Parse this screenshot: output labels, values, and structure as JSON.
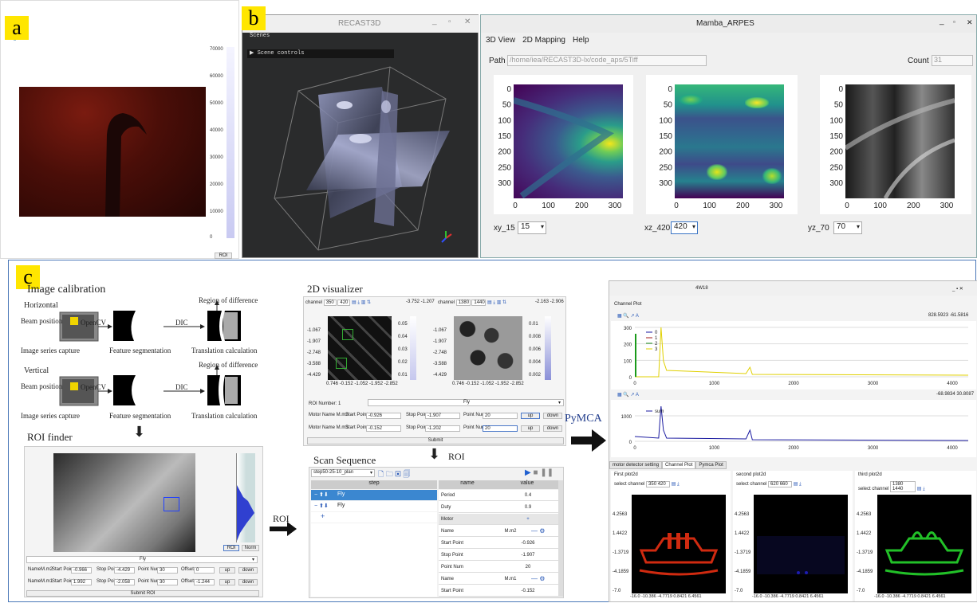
{
  "labels": {
    "a": "a",
    "b": "b",
    "c": "c"
  },
  "panel_a": {
    "roi_button": "ROI",
    "colorbar_ticks": [
      "70000",
      "60000",
      "50000",
      "40000",
      "30000",
      "20000",
      "10000",
      "0"
    ]
  },
  "panel_b": {
    "title": "RECAST3D",
    "menu": "Scenes",
    "scene_controls": "▶ Scene controls",
    "win_min": "_",
    "win_max": "▫",
    "win_close": "✕"
  },
  "panel_arpes": {
    "title": "Mamba_ARPES",
    "menu": [
      "3D View",
      "2D Mapping",
      "Help"
    ],
    "path_label": "Path",
    "path_value": "/home/iea/RECAST3D-lx/code_aps/5Tiff",
    "count_label": "Count",
    "count_value": "31",
    "y_ticks": [
      "0",
      "50",
      "100",
      "150",
      "200",
      "250",
      "300"
    ],
    "x_ticks": [
      "0",
      "100",
      "200",
      "300"
    ],
    "plots": [
      {
        "label": "xy_15",
        "value": "15"
      },
      {
        "label": "xz_420",
        "value": "420"
      },
      {
        "label": "yz_70",
        "value": "70"
      }
    ],
    "win_min": "_",
    "win_max": "▫",
    "win_close": "✕"
  },
  "panel_c": {
    "image_calibration": "Image calibration",
    "horizontal": "Horizontal",
    "vertical": "Vertical",
    "beam_position": "Beam position",
    "opencv": "OpenCV",
    "dic": "DIC",
    "region_of_difference": "Region of difference",
    "image_series_capture": "Image series capture",
    "feature_segmentation": "Feature segmentation",
    "translation_calculation": "Translation calculation",
    "roi_finder": "ROI finder",
    "roi_arrow": "ROI",
    "roi_panel": {
      "mode": "Fly",
      "row1": {
        "name": "Name",
        "motor": "M.m2",
        "start": "Start Point",
        "start_val": "-0.966",
        "stop": "Stop Point",
        "stop_val": "-4.429",
        "num": "Point Num",
        "num_val": "30",
        "offset": "Offset",
        "offset_val": "0",
        "up": "up",
        "down": "down"
      },
      "row2": {
        "name": "Name",
        "motor": "M.m1",
        "start": "Start Point",
        "start_val": "1.992",
        "stop": "Stop Point",
        "stop_val": "-2.058",
        "num": "Point Num",
        "num_val": "30",
        "offset": "Offset",
        "offset_val": "-1.244",
        "up": "up",
        "down": "down"
      },
      "submit": "Submit ROI",
      "roi_btn": "ROI",
      "norm_btn": "Norm"
    },
    "viz_title": "2D visualizer",
    "viz": {
      "channel1": "channel",
      "ch1_a": "350",
      "ch1_b": "420",
      "coord1": "-3.752 -1.207",
      "channel2": "channel",
      "ch2_a": "1380",
      "ch2_b": "1440",
      "coord2": "-2.163 -2.906",
      "y_ticks": [
        "-1.067",
        "-1.907",
        "-2.748",
        "-3.588",
        "-4.429"
      ],
      "x_ticks1": "0.746 -0.152 -1.052 -1.952 -2.852",
      "x_ticks2": "0.746 -0.152 -1.052 -1.952 -2.852",
      "cb1": [
        "0.05",
        "0.04",
        "0.03",
        "0.02",
        "0.01"
      ],
      "cb2": [
        "0.01",
        "0.008",
        "0.006",
        "0.004",
        "0.002"
      ],
      "roi_number": "ROI Number: 1",
      "fly": "Fly",
      "r1": {
        "motor": "Motor Name M.m2",
        "start": "Start Point",
        "start_val": "-0.926",
        "stop": "Stop Point",
        "stop_val": "-1.907",
        "num": "Point Num",
        "num_val": "20",
        "up": "up",
        "down": "down"
      },
      "r2": {
        "motor": "Motor Name M.m1",
        "start": "Start Point",
        "start_val": "-0.152",
        "stop": "Stop Point",
        "stop_val": "-1.202",
        "num": "Point Num",
        "num_val": "20",
        "up": "up",
        "down": "down"
      },
      "submit": "Submit"
    },
    "roi_label2": "ROI",
    "scan_title": "Scan Sequence",
    "scan": {
      "plan": "step50-25-10_plan",
      "step_header": "step",
      "name_header": "name",
      "value_header": "value",
      "steps": [
        "Fly",
        "Fly"
      ],
      "rows": [
        {
          "n": "Period",
          "v": "0.4"
        },
        {
          "n": "Duty",
          "v": "0.9"
        },
        {
          "n": "Motor",
          "v": "+"
        },
        {
          "n": "Name",
          "v": "M.m2"
        },
        {
          "n": "Start Point",
          "v": "-0.926"
        },
        {
          "n": "Stop Point",
          "v": "-1.907"
        },
        {
          "n": "Point Num",
          "v": "20"
        },
        {
          "n": "Name",
          "v": "M.m1"
        },
        {
          "n": "Start Point",
          "v": "-0.152"
        }
      ]
    },
    "pymca": "PyMCA",
    "pymca_win": {
      "title": "4W18",
      "channel_plot": "Channel Plot",
      "coord1": "828.5923  -61.5816",
      "coord2": "-68.9834  30.8087",
      "p1_y": [
        "300",
        "200",
        "100",
        "0"
      ],
      "p1_x": [
        "0",
        "1000",
        "2000",
        "3000",
        "4000"
      ],
      "legend": [
        "0",
        "1",
        "2",
        "3"
      ],
      "p2_y": [
        "1000",
        "0"
      ],
      "p2_x": [
        "0",
        "1000",
        "2000",
        "3000",
        "4000"
      ],
      "legend2": "sum",
      "tabs": [
        "motor detector setting",
        "Channel Plot",
        "Pymca Plot"
      ],
      "sub": [
        {
          "title": "First plot2d",
          "ch_label": "select channel",
          "ch": "350 420"
        },
        {
          "title": "second plot2d",
          "ch_label": "select channel",
          "ch": "620 660"
        },
        {
          "title": "third plot2d",
          "ch_label": "select channel",
          "ch": "1380 1440"
        }
      ],
      "img_y": [
        "4.2563",
        "1.4422",
        "-1.3719",
        "-4.1859",
        "-7.0"
      ],
      "img_x": "-16.0  -10.386  -4.7719  0.8421  6.4561",
      "colors": {
        "red": "#d02a10",
        "blue": "#1c1cb0",
        "green": "#22c028"
      }
    }
  }
}
